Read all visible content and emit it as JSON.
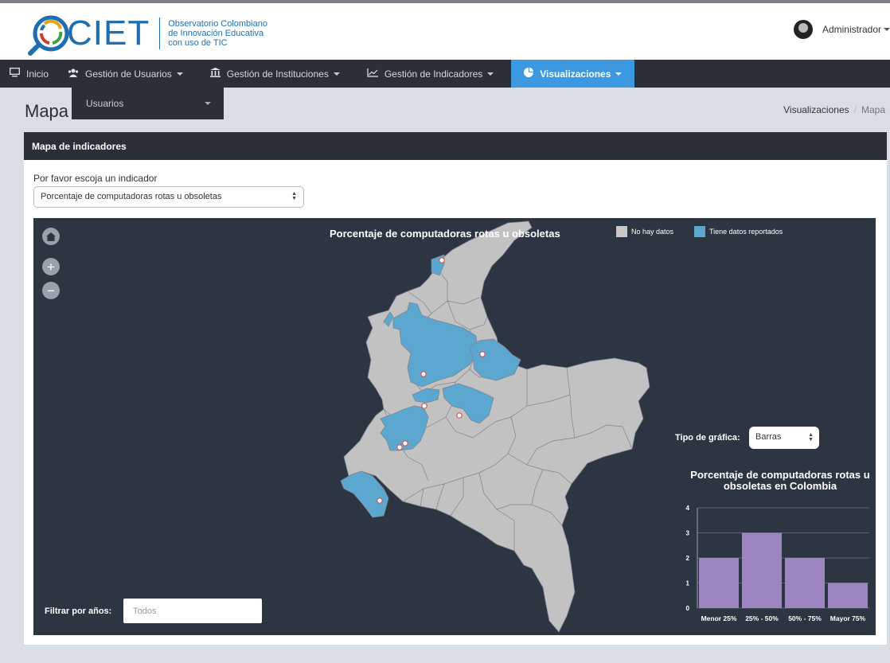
{
  "header": {
    "logo_text": "CIET",
    "logo_sub": [
      "Observatorio Colombiano",
      "de Innovación Educativa",
      "con uso de TIC"
    ],
    "user_name": "Administrador"
  },
  "nav": {
    "items": [
      {
        "label": "Inicio",
        "icon": "monitor-icon"
      },
      {
        "label": "Gestión de Usuarios",
        "icon": "users-icon"
      },
      {
        "label": "Gestión de Instituciones",
        "icon": "institution-icon"
      },
      {
        "label": "Gestión de Indicadores",
        "icon": "line-chart-icon"
      },
      {
        "label": "Visualizaciones",
        "icon": "pie-chart-icon"
      }
    ],
    "dropdown_item": "Usuarios"
  },
  "page": {
    "title": "Mapa",
    "breadcrumb": [
      "Visualizaciones",
      "Mapa"
    ]
  },
  "panel": {
    "title": "Mapa de indicadores",
    "indicator_label": "Por favor escoja un indicador",
    "indicator_value": "Porcentaje de computadoras rotas u obsoletas"
  },
  "map": {
    "title": "Porcentaje de computadoras rotas u obsoletas",
    "legend": [
      {
        "label": "No hay datos",
        "color": "#c8c8c8"
      },
      {
        "label": "Tiene datos reportados",
        "color": "#5ba7cf"
      }
    ],
    "chart_type_label": "Tipo de gráfica:",
    "chart_type_value": "Barras",
    "filter_label": "Filtrar por años:",
    "filter_placeholder": "Todos"
  },
  "chart_data": {
    "type": "bar",
    "title": "Porcentaje de computadoras rotas u obsoletas en Colombia",
    "categories": [
      "Menor 25%",
      "25% - 50%",
      "50% - 75%",
      "Mayor 75%"
    ],
    "values": [
      2,
      3,
      2,
      1
    ],
    "ylim": [
      0,
      4
    ],
    "yticks": [
      "0",
      "1",
      "2",
      "3",
      "4"
    ],
    "bar_color": "#9b86c2",
    "grid": true
  }
}
